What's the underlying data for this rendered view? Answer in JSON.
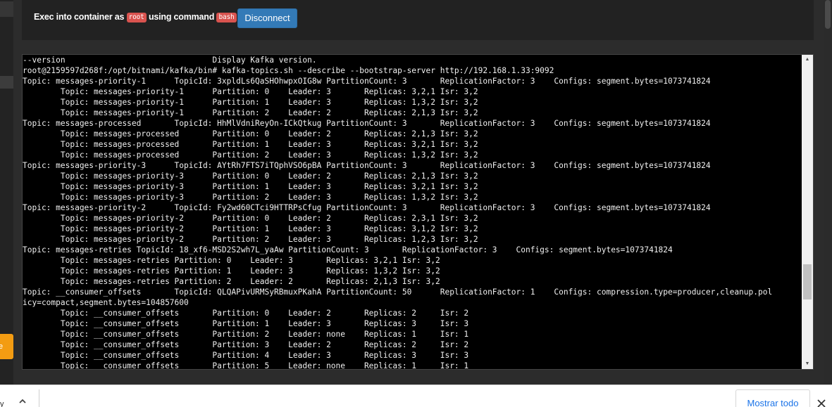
{
  "left_panel": {
    "orange_button_fragment": "e"
  },
  "exec_bar": {
    "prefix": "Exec into container as",
    "user_badge": "root",
    "middle": "using command",
    "command_badge": "bash",
    "disconnect_label": "Disconnect"
  },
  "terminal": {
    "lines": [
      "--version                               Display Kafka version.",
      "root@2159597d268f:/opt/bitnami/kafka/bin# kafka-topics.sh --describe --bootstrap-server http://192.168.1.33:9092",
      "Topic: messages-priority-1      TopicId: 3xpldLs6QaSHOhwpxOIG8w PartitionCount: 3       ReplicationFactor: 3    Configs: segment.bytes=1073741824",
      "        Topic: messages-priority-1      Partition: 0    Leader: 3       Replicas: 3,2,1 Isr: 3,2",
      "        Topic: messages-priority-1      Partition: 1    Leader: 3       Replicas: 1,3,2 Isr: 3,2",
      "        Topic: messages-priority-1      Partition: 2    Leader: 2       Replicas: 2,1,3 Isr: 3,2",
      "Topic: messages-processed       TopicId: HhMlVdniReyOn-ICkQtkug PartitionCount: 3       ReplicationFactor: 3    Configs: segment.bytes=1073741824",
      "        Topic: messages-processed       Partition: 0    Leader: 2       Replicas: 2,1,3 Isr: 3,2",
      "        Topic: messages-processed       Partition: 1    Leader: 3       Replicas: 3,2,1 Isr: 3,2",
      "        Topic: messages-processed       Partition: 2    Leader: 3       Replicas: 1,3,2 Isr: 3,2",
      "Topic: messages-priority-3      TopicId: AYtRh7FTS7iTQphVSO6pBA PartitionCount: 3       ReplicationFactor: 3    Configs: segment.bytes=1073741824",
      "        Topic: messages-priority-3      Partition: 0    Leader: 2       Replicas: 2,1,3 Isr: 3,2",
      "        Topic: messages-priority-3      Partition: 1    Leader: 3       Replicas: 3,2,1 Isr: 3,2",
      "        Topic: messages-priority-3      Partition: 2    Leader: 3       Replicas: 1,3,2 Isr: 3,2",
      "Topic: messages-priority-2      TopicId: Fy2wd60CTci9HTTRPsCfug PartitionCount: 3       ReplicationFactor: 3    Configs: segment.bytes=1073741824",
      "        Topic: messages-priority-2      Partition: 0    Leader: 2       Replicas: 2,3,1 Isr: 3,2",
      "        Topic: messages-priority-2      Partition: 1    Leader: 3       Replicas: 3,1,2 Isr: 3,2",
      "        Topic: messages-priority-2      Partition: 2    Leader: 3       Replicas: 1,2,3 Isr: 3,2",
      "Topic: messages-retries TopicId: 18_xf6-MSD2S2wh7L_yaAw PartitionCount: 3       ReplicationFactor: 3    Configs: segment.bytes=1073741824",
      "        Topic: messages-retries Partition: 0    Leader: 3       Replicas: 3,2,1 Isr: 3,2",
      "        Topic: messages-retries Partition: 1    Leader: 3       Replicas: 1,3,2 Isr: 3,2",
      "        Topic: messages-retries Partition: 2    Leader: 2       Replicas: 2,1,3 Isr: 3,2",
      "Topic: __consumer_offsets       TopicId: QLQAPivURMSyRBmuxPKahA PartitionCount: 50      ReplicationFactor: 1    Configs: compression.type=producer,cleanup.pol",
      "icy=compact,segment.bytes=104857600",
      "        Topic: __consumer_offsets       Partition: 0    Leader: 2       Replicas: 2     Isr: 2",
      "        Topic: __consumer_offsets       Partition: 1    Leader: 3       Replicas: 3     Isr: 3",
      "        Topic: __consumer_offsets       Partition: 2    Leader: none    Replicas: 1     Isr: 1",
      "        Topic: __consumer_offsets       Partition: 3    Leader: 2       Replicas: 2     Isr: 2",
      "        Topic: __consumer_offsets       Partition: 4    Leader: 3       Replicas: 3     Isr: 3",
      "        Topic: __consumer_offsets       Partition: 5    Leader: none    Replicas: 1     Isr: 1"
    ]
  },
  "download_bar": {
    "left_fragment": "y",
    "show_all_label": "Mostrar todo"
  },
  "icons": [
    "chevron-up-icon",
    "close-icon",
    "scroll-up-arrow-icon",
    "scroll-down-arrow-icon"
  ]
}
